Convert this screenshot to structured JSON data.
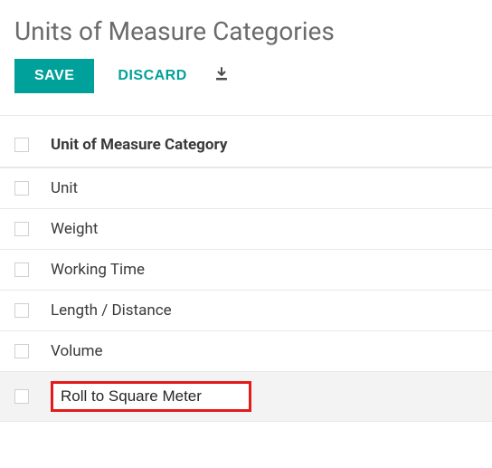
{
  "page_title": "Units of Measure Categories",
  "toolbar": {
    "save_label": "SAVE",
    "discard_label": "DISCARD"
  },
  "table": {
    "header": "Unit of Measure Category",
    "rows": [
      {
        "name": "Unit"
      },
      {
        "name": "Weight"
      },
      {
        "name": "Working Time"
      },
      {
        "name": "Length / Distance"
      },
      {
        "name": "Volume"
      }
    ],
    "editing_value": "Roll to Square Meter"
  }
}
